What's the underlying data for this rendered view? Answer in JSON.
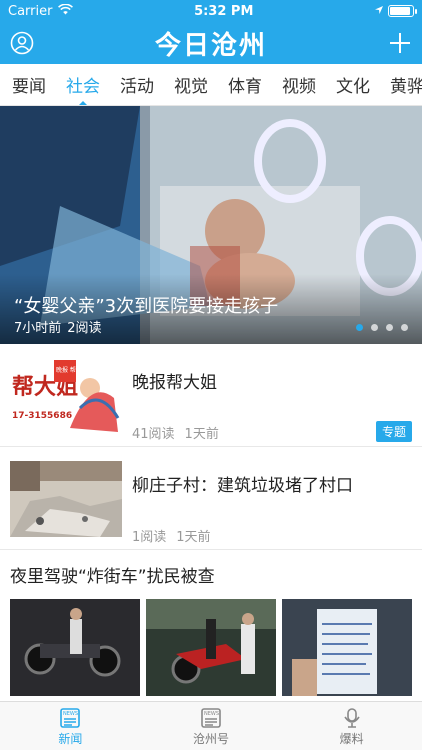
{
  "status": {
    "carrier": "Carrier",
    "time": "5:32 PM",
    "battery_level": 0.9
  },
  "header": {
    "title": "今日沧州",
    "user_icon": "user-circle-icon",
    "add_icon": "plus-icon"
  },
  "tabs": [
    {
      "label": "要闻",
      "active": false
    },
    {
      "label": "社会",
      "active": true
    },
    {
      "label": "活动",
      "active": false
    },
    {
      "label": "视觉",
      "active": false
    },
    {
      "label": "体育",
      "active": false
    },
    {
      "label": "视频",
      "active": false
    },
    {
      "label": "文化",
      "active": false
    },
    {
      "label": "黄骅",
      "active": false
    }
  ],
  "hero": {
    "title": "“女婴父亲”3次到医院要接走孩子",
    "time": "7小时前",
    "reads": "2阅读",
    "slide_count": 4,
    "active_slide": 1
  },
  "articles": [
    {
      "title": "晚报帮大姐",
      "reads": "41阅读",
      "time": "1天前",
      "badge": "专题",
      "thumb_text": "帮大姐",
      "thumb_phone": "17-3155686",
      "thumb_stamp": "晚报 帮大姐"
    },
    {
      "title": "柳庄子村：建筑垃圾堵了村口",
      "reads": "1阅读",
      "time": "1天前",
      "badge": ""
    }
  ],
  "gallery": {
    "title": "夜里驾驶“炸街车”扰民被查"
  },
  "bottom_nav": [
    {
      "label": "新闻",
      "icon": "news-icon",
      "active": true
    },
    {
      "label": "沧州号",
      "icon": "news-icon",
      "active": false
    },
    {
      "label": "爆料",
      "icon": "microphone-icon",
      "active": false
    }
  ],
  "colors": {
    "accent": "#27a9ea"
  }
}
